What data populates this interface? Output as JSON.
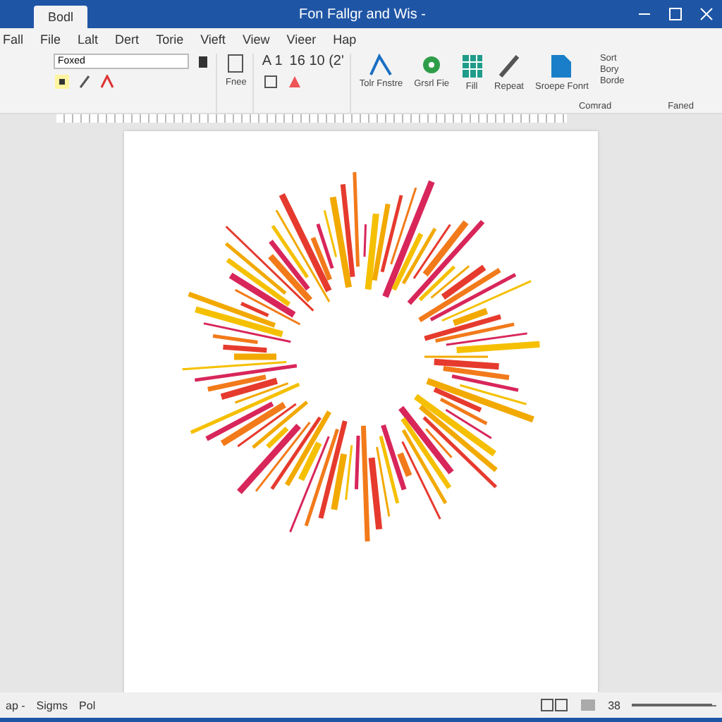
{
  "window": {
    "tab": "Bodl",
    "title": "Fon Fallgr and Wis -"
  },
  "menu": [
    {
      "label": "Fall",
      "selected": false
    },
    {
      "label": "File",
      "selected": false
    },
    {
      "label": "Lalt",
      "selected": false
    },
    {
      "label": "Dert",
      "selected": false
    },
    {
      "label": "Torie",
      "selected": false
    },
    {
      "label": "Vieft",
      "selected": false
    },
    {
      "label": "View",
      "selected": false
    },
    {
      "label": "Vieer",
      "selected": false
    },
    {
      "label": "Hap",
      "selected": false
    }
  ],
  "ribbon": {
    "font_name": "Foxed",
    "styles_label": "Fnee",
    "size_text": "A 1",
    "numbers": "16 10 (2'",
    "text_effects": "Tolr Fnstre",
    "shape_label": "Grsrl Fie",
    "fill_label": "Fill",
    "repeat_label": "Repeat",
    "font_label": "Sroepe Fonrt",
    "side_items": [
      "Sort",
      "Bory",
      "Borde"
    ],
    "groups": [
      "Comrad",
      "Faned"
    ]
  },
  "status": {
    "items": [
      "ap -",
      "Sigms",
      "Pol"
    ],
    "zoom": "38",
    "zoom_slider": {
      "level": 0.95
    }
  }
}
